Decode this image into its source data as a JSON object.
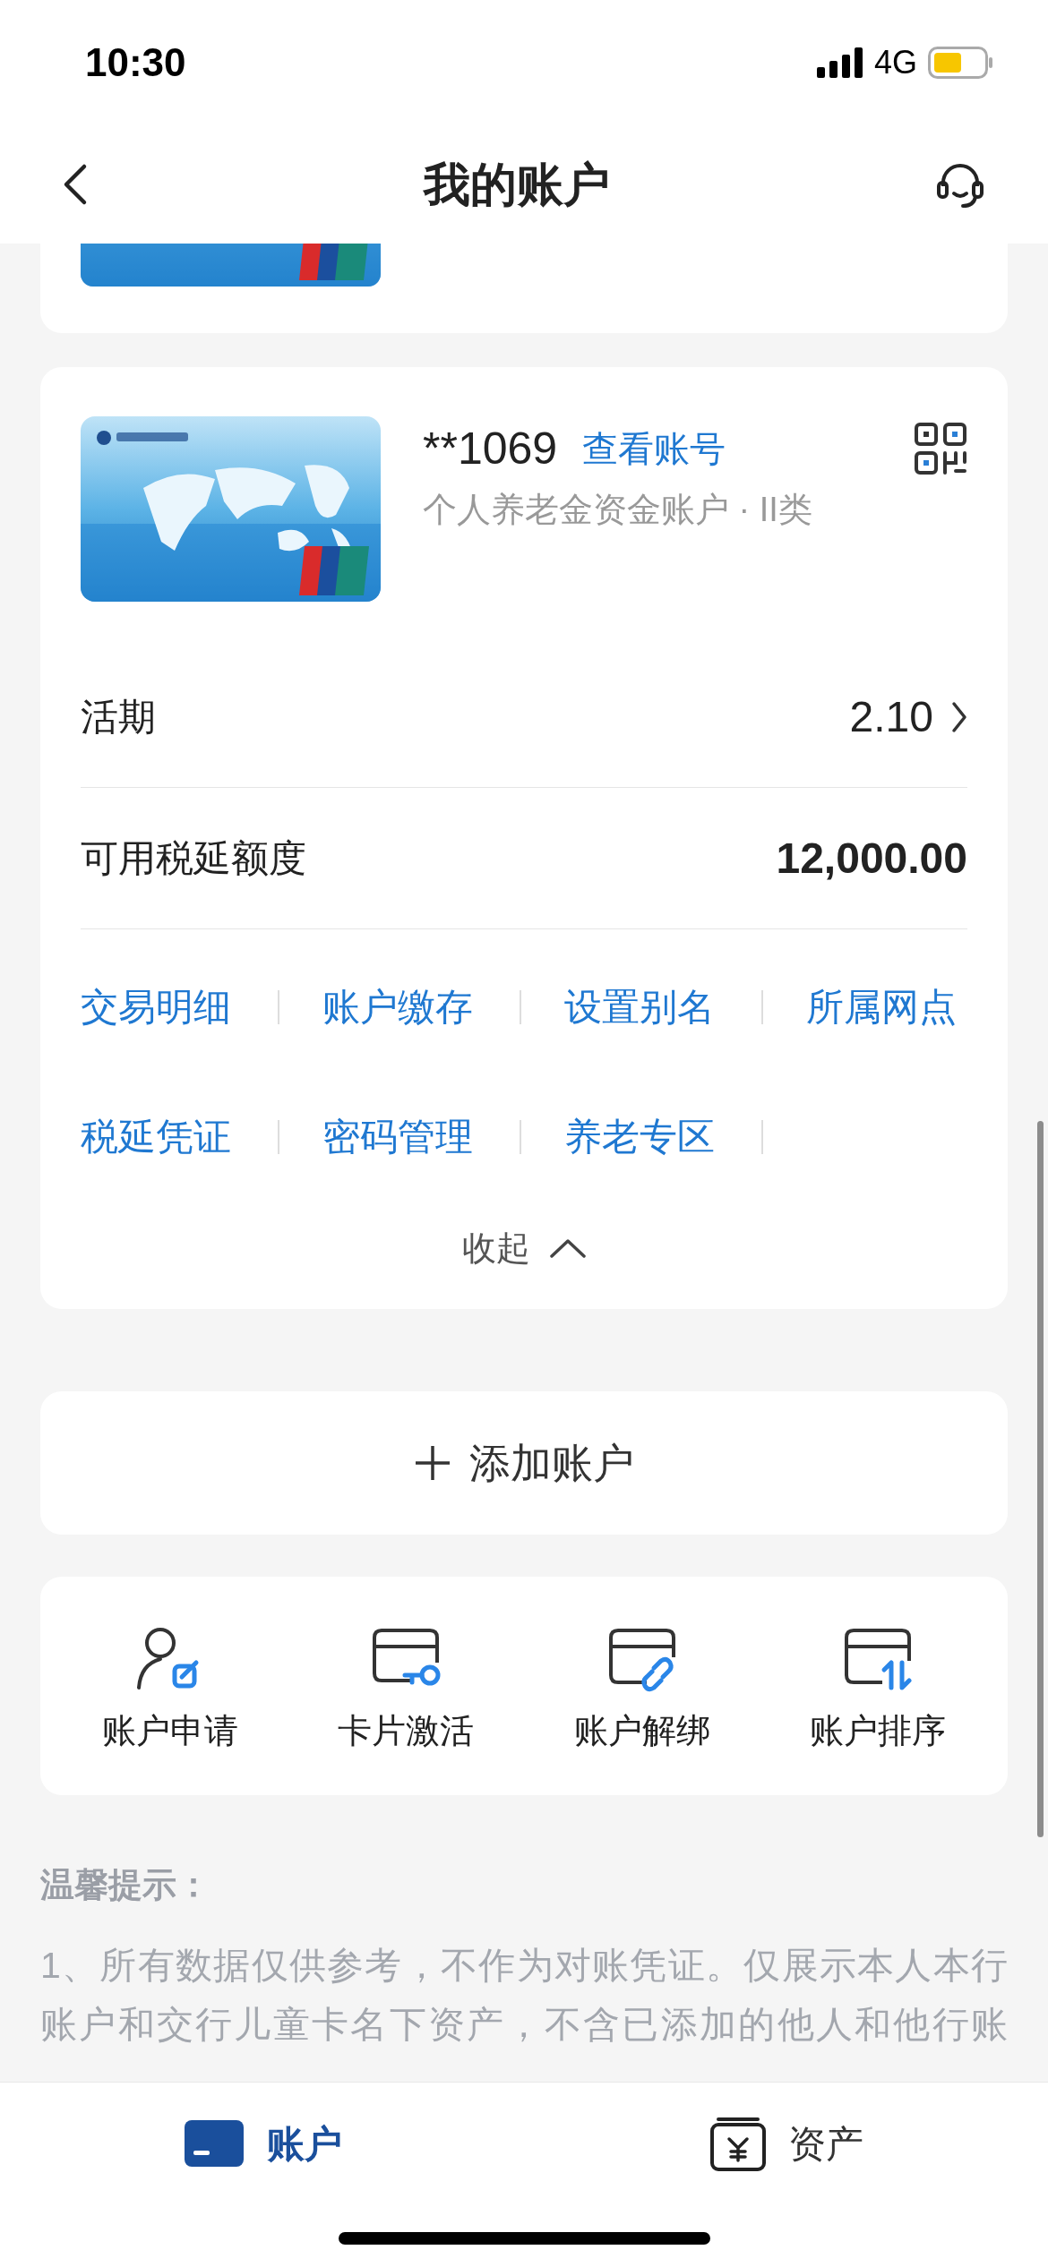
{
  "status_bar": {
    "time": "10:30",
    "network": "4G"
  },
  "nav": {
    "title": "我的账户"
  },
  "account": {
    "number": "**1069",
    "view_link": "查看账号",
    "type": "个人养老金资金账户 · II类",
    "rows": [
      {
        "label": "活期",
        "value": "2.10",
        "has_chevron": true,
        "bold": false
      },
      {
        "label": "可用税延额度",
        "value": "12,000.00",
        "has_chevron": false,
        "bold": true
      }
    ],
    "actions": [
      "交易明细",
      "账户缴存",
      "设置别名",
      "所属网点",
      "税延凭证",
      "密码管理",
      "养老专区"
    ],
    "collapse": "收起"
  },
  "add_account": "添加账户",
  "features": [
    {
      "label": "账户申请",
      "kind": "person"
    },
    {
      "label": "卡片激活",
      "kind": "key"
    },
    {
      "label": "账户解绑",
      "kind": "unlink"
    },
    {
      "label": "账户排序",
      "kind": "sort"
    }
  ],
  "tips": {
    "title": "温馨提示：",
    "lines": [
      "1、所有数据仅供参考，不作为对账凭证。仅展示本人本行",
      "账户和交行儿童卡名下资产，不含已添加的他人和他行账"
    ]
  },
  "tabs": [
    {
      "label": "账户",
      "kind": "card",
      "selected": true
    },
    {
      "label": "资产",
      "kind": "wallet",
      "selected": false
    }
  ]
}
